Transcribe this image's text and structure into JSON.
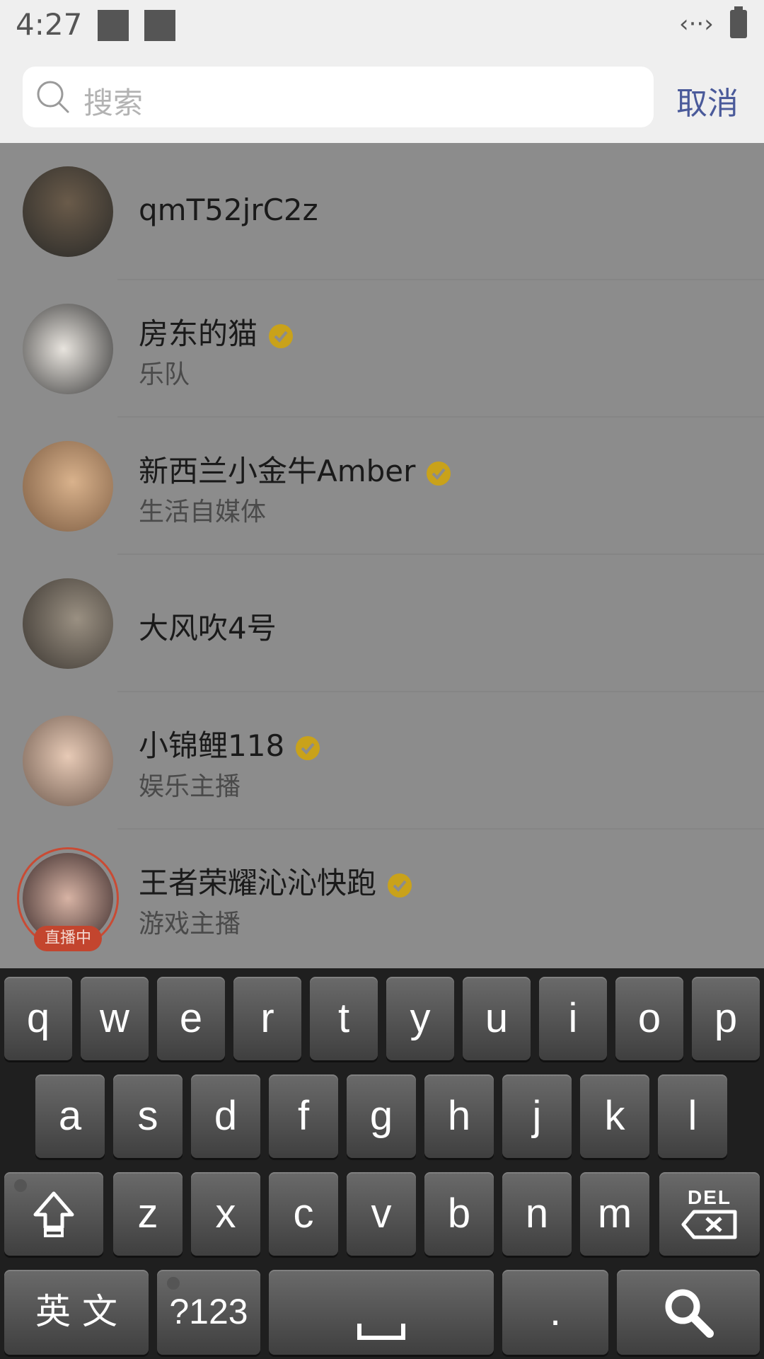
{
  "status_bar": {
    "time": "4:27",
    "icons": [
      "notification-square",
      "notification-square",
      "code-icon",
      "battery-icon"
    ]
  },
  "search": {
    "placeholder": "搜索",
    "cancel_label": "取消"
  },
  "results": [
    {
      "name": "qmT52jrC2z",
      "subtitle": "",
      "verified": false,
      "live": false,
      "avatar_color": "#3d3a35"
    },
    {
      "name": "房东的猫",
      "subtitle": "乐队",
      "verified": true,
      "live": false,
      "avatar_color": "#c9c4bd"
    },
    {
      "name": "新西兰小金牛Amber",
      "subtitle": "生活自媒体",
      "verified": true,
      "live": false,
      "avatar_color": "#b98a63"
    },
    {
      "name": "大风吹4号",
      "subtitle": "",
      "verified": false,
      "live": false,
      "avatar_color": "#5b5650"
    },
    {
      "name": "小锦鲤118",
      "subtitle": "娱乐主播",
      "verified": true,
      "live": false,
      "avatar_color": "#d7b7a2"
    },
    {
      "name": "王者荣耀沁沁快跑",
      "subtitle": "游戏主播",
      "verified": true,
      "live": true,
      "live_label": "直播中",
      "avatar_color": "#6b4a4a"
    }
  ],
  "keyboard": {
    "row1": [
      "q",
      "w",
      "e",
      "r",
      "t",
      "y",
      "u",
      "i",
      "o",
      "p"
    ],
    "row2": [
      "a",
      "s",
      "d",
      "f",
      "g",
      "h",
      "j",
      "k",
      "l"
    ],
    "row3": [
      "z",
      "x",
      "c",
      "v",
      "b",
      "n",
      "m"
    ],
    "del_label": "DEL",
    "lang_label": "英 文",
    "num_label": "?123",
    "period_label": "."
  },
  "colors": {
    "accent": "#4a5a9a",
    "verified": "#c9a21a",
    "live": "#c3452e"
  }
}
